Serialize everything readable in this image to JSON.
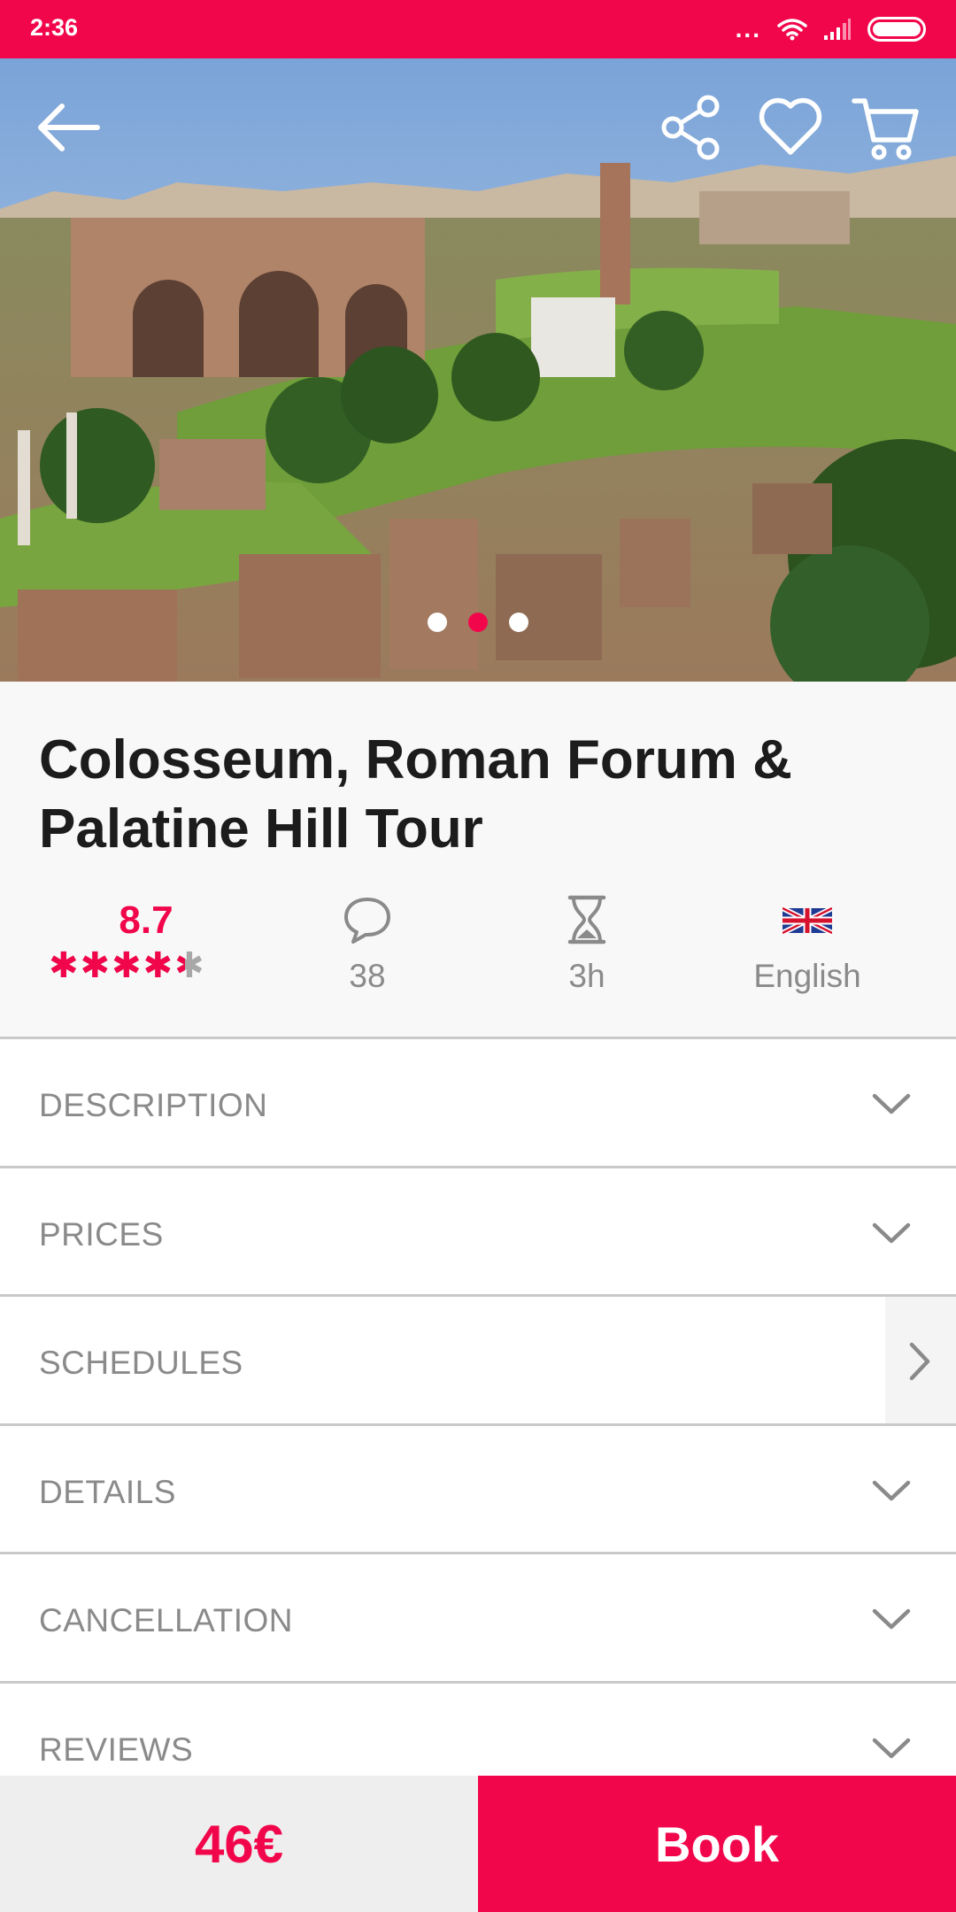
{
  "status_bar": {
    "time": "2:36",
    "dots": "...",
    "icons": [
      "wifi-icon",
      "signal-icon",
      "battery-icon"
    ],
    "background": "#f2064b"
  },
  "hero": {
    "image_description": "Aerial view of the Roman Forum ruins with the Colosseum in the background",
    "carousel_total": 3,
    "carousel_active": 2,
    "actions": [
      "back-arrow-icon",
      "share-icon",
      "heart-icon",
      "cart-icon"
    ]
  },
  "tour": {
    "title": "Colosseum, Roman Forum & Palatine Hill Tour",
    "rating": "8.7",
    "rating_stars_fraction": 0.87,
    "stars_glyphs": "✱✱✱✱✱",
    "comments": "38",
    "duration": "3h",
    "language": "English"
  },
  "sections": [
    {
      "label": "DESCRIPTION",
      "indicator": "chevron-down-icon"
    },
    {
      "label": "PRICES",
      "indicator": "chevron-down-icon"
    },
    {
      "label": "SCHEDULES",
      "indicator": "chevron-right-icon"
    },
    {
      "label": "DETAILS",
      "indicator": "chevron-down-icon"
    },
    {
      "label": "CANCELLATION",
      "indicator": "chevron-down-icon"
    },
    {
      "label": "REVIEWS",
      "indicator": "chevron-down-icon"
    }
  ],
  "bottom_bar": {
    "price": "46€",
    "book_label": "Book"
  },
  "colors": {
    "accent": "#f2064b",
    "text_dark": "#1c1c1c",
    "text_muted": "#8a8a8a",
    "divider": "#c9c9c9"
  }
}
